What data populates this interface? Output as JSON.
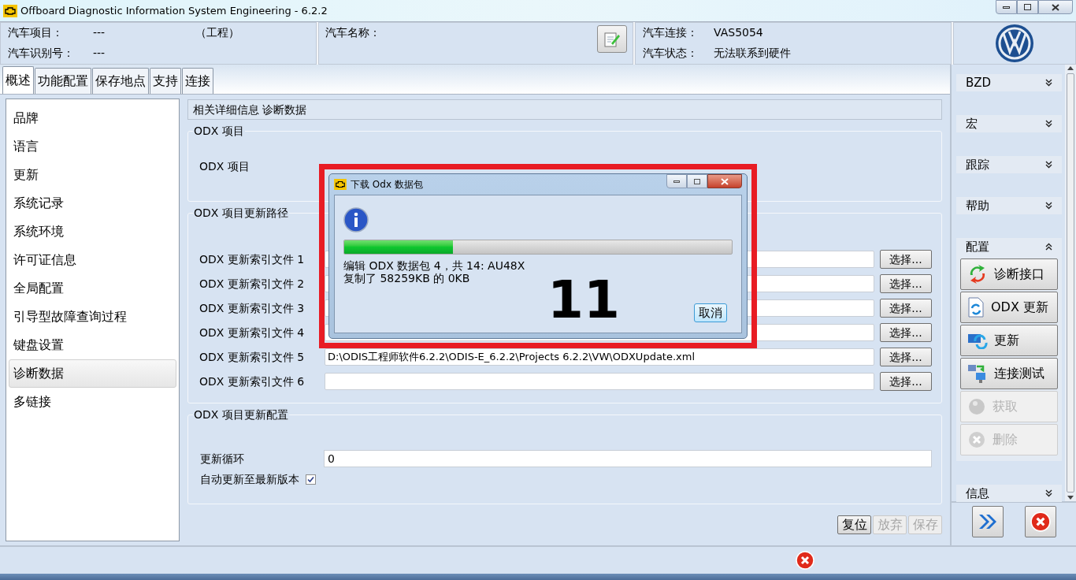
{
  "window": {
    "title": "Offboard Diagnostic Information System Engineering - 6.2.2"
  },
  "header": {
    "project_label": "汽车项目：",
    "project_value": "---",
    "project_mode": "（工程）",
    "vin_label": "汽车识别号：",
    "vin_value": "---",
    "name_label": "汽车名称：",
    "connection_label": "汽车连接：",
    "connection_value": "VAS5054",
    "status_label": "汽车状态：",
    "status_value": "无法联系到硬件"
  },
  "tabs": [
    {
      "label": "概述",
      "selected": true
    },
    {
      "label": "功能配置",
      "selected": false
    },
    {
      "label": "保存地点",
      "selected": false
    },
    {
      "label": "支持",
      "selected": false
    },
    {
      "label": "连接",
      "selected": false
    }
  ],
  "sidebar": {
    "items": [
      {
        "label": "品牌",
        "selected": false
      },
      {
        "label": "语言",
        "selected": false
      },
      {
        "label": "更新",
        "selected": false
      },
      {
        "label": "系统记录",
        "selected": false
      },
      {
        "label": "系统环境",
        "selected": false
      },
      {
        "label": "许可证信息",
        "selected": false
      },
      {
        "label": "全局配置",
        "selected": false
      },
      {
        "label": "引导型故障查询过程",
        "selected": false
      },
      {
        "label": "键盘设置",
        "selected": false
      },
      {
        "label": "诊断数据",
        "selected": true
      },
      {
        "label": "多链接",
        "selected": false
      }
    ]
  },
  "content": {
    "title": "相关详细信息 诊断数据",
    "project_section": {
      "title": "ODX 项目",
      "label": "ODX 项目"
    },
    "path_section": {
      "title": "ODX 项目更新路径",
      "rows": [
        {
          "label": "ODX 更新索引文件 1",
          "button": "选择..."
        },
        {
          "label": "ODX 更新索引文件 2",
          "button": "选择..."
        },
        {
          "label": "ODX 更新索引文件 3",
          "button": "选择..."
        },
        {
          "label": "ODX 更新索引文件 4",
          "button": "选择..."
        },
        {
          "label": "ODX 更新索引文件 5",
          "value": "D:\\ODIS工程师软件6.2.2\\ODIS-E_6.2.2\\Projects 6.2.2\\VW\\ODXUpdate.xml",
          "button": "选择..."
        },
        {
          "label": "ODX 更新索引文件 6",
          "button": "选择..."
        }
      ]
    },
    "config_section": {
      "title": "ODX 项目更新配置",
      "cycle_label": "更新循环",
      "cycle_value": "0",
      "auto_label": "自动更新至最新版本",
      "auto_checked": true
    },
    "buttons": [
      {
        "label": "复位",
        "disabled": false
      },
      {
        "label": "放弃",
        "disabled": true
      },
      {
        "label": "保存",
        "disabled": true
      }
    ]
  },
  "right_panel": {
    "sections": [
      {
        "label": "BZD",
        "expanded": false
      },
      {
        "label": "宏",
        "expanded": false
      },
      {
        "label": "跟踪",
        "expanded": false
      },
      {
        "label": "帮助",
        "expanded": false
      },
      {
        "label": "配置",
        "expanded": true,
        "children": [
          {
            "label": "诊断接口",
            "kind": "interface",
            "disabled": false
          },
          {
            "label": "ODX 更新",
            "kind": "document",
            "disabled": false
          },
          {
            "label": "更新",
            "kind": "refresh",
            "disabled": false
          },
          {
            "label": "连接测试",
            "kind": "network",
            "disabled": false
          },
          {
            "label": "获取",
            "kind": "fetch",
            "disabled": true
          },
          {
            "label": "删除",
            "kind": "delete",
            "disabled": true
          }
        ]
      },
      {
        "label": "信息",
        "expanded": false
      }
    ]
  },
  "dialog": {
    "title": "下载 Odx 数据包",
    "level": 0.28,
    "line_1": "编辑 ODX 数据包 4，共 14: AU48X",
    "line_2": "复制了 58259KB 的 0KB",
    "count": "11",
    "cancel": "取消"
  }
}
